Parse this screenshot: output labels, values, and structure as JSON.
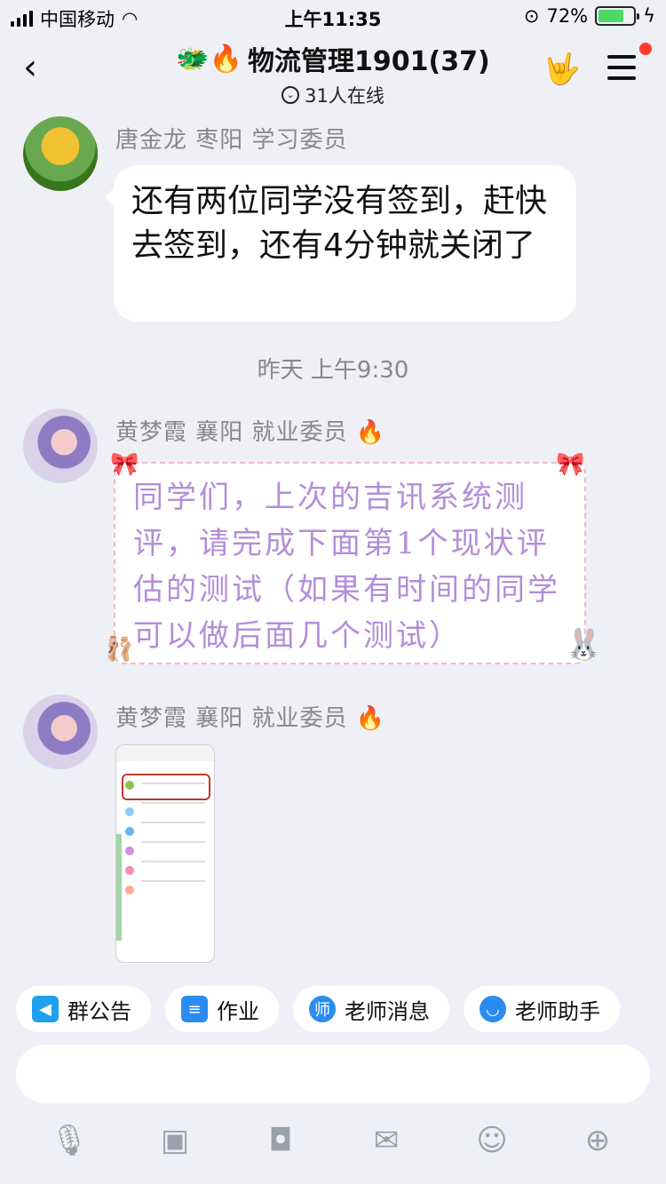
{
  "status": {
    "carrier": "中国移动",
    "time": "上午11:35",
    "battery": "72%",
    "battery_level": 0.72
  },
  "nav": {
    "back_icon": "chevron-left-icon",
    "title": "物流管理1901(37)",
    "title_emojis": "🐲🔥",
    "online": "31人在线",
    "hand_icon": "rock-hand-icon",
    "menu_icon": "menu-icon"
  },
  "messages": [
    {
      "sender": "唐金龙 枣阳 学习委员",
      "text": "还有两位同学没有签到，赶快去签到，还有4分钟就关闭了"
    },
    {
      "sender": "黄梦霞  襄阳 就业委员",
      "sender_badge": "🔥",
      "text": "同学们，上次的吉讯系统测评，请完成下面第1个现状评估的测试（如果有时间的同学可以做后面几个测试）"
    },
    {
      "sender": "黄梦霞  襄阳 就业委员",
      "sender_badge": "🔥",
      "image": "screenshot-thumbnail"
    }
  ],
  "timestamp": "昨天 上午9:30",
  "quick_actions": [
    {
      "label": "群公告",
      "icon": "megaphone-icon",
      "color": "#1ea0ef"
    },
    {
      "label": "作业",
      "icon": "document-icon",
      "color": "#2b8cf0"
    },
    {
      "label": "老师消息",
      "icon": "teacher-icon",
      "color": "#2b8cf0"
    },
    {
      "label": "老师助手",
      "icon": "assistant-icon",
      "color": "#2b8cf0"
    }
  ],
  "toolbar": [
    {
      "icon": "microphone-icon"
    },
    {
      "icon": "image-icon"
    },
    {
      "icon": "camera-icon"
    },
    {
      "icon": "red-packet-icon"
    },
    {
      "icon": "emoji-icon"
    },
    {
      "icon": "plus-icon"
    }
  ]
}
